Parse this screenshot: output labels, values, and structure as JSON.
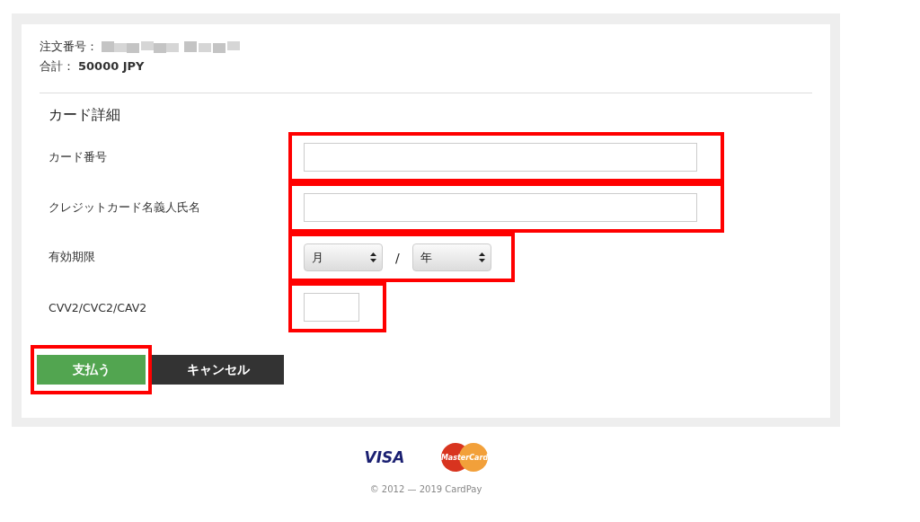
{
  "order": {
    "number_label": "注文番号：",
    "number_redacted": true,
    "total_label": "合計：",
    "total_value": "50000 JPY"
  },
  "section_title": "カード詳細",
  "fields": [
    {
      "kind": "text",
      "label": "カード番号",
      "highlighted": true
    },
    {
      "kind": "text",
      "label": "クレジットカード名義人氏名",
      "highlighted": true
    },
    {
      "kind": "expiry",
      "label": "有効期限",
      "month": "月",
      "separator": "/",
      "year": "年",
      "highlighted": true
    },
    {
      "kind": "short",
      "label": "CVV2/CVC2/CAV2",
      "highlighted": true
    }
  ],
  "buttons": [
    {
      "kind": "primary",
      "label": "支払う",
      "highlighted": true
    },
    {
      "kind": "secondary",
      "label": "キャンセル",
      "highlighted": false
    }
  ],
  "footer": {
    "logos": [
      "VISA",
      "MasterCard"
    ],
    "copyright": "© 2012 — 2019 CardPay"
  }
}
